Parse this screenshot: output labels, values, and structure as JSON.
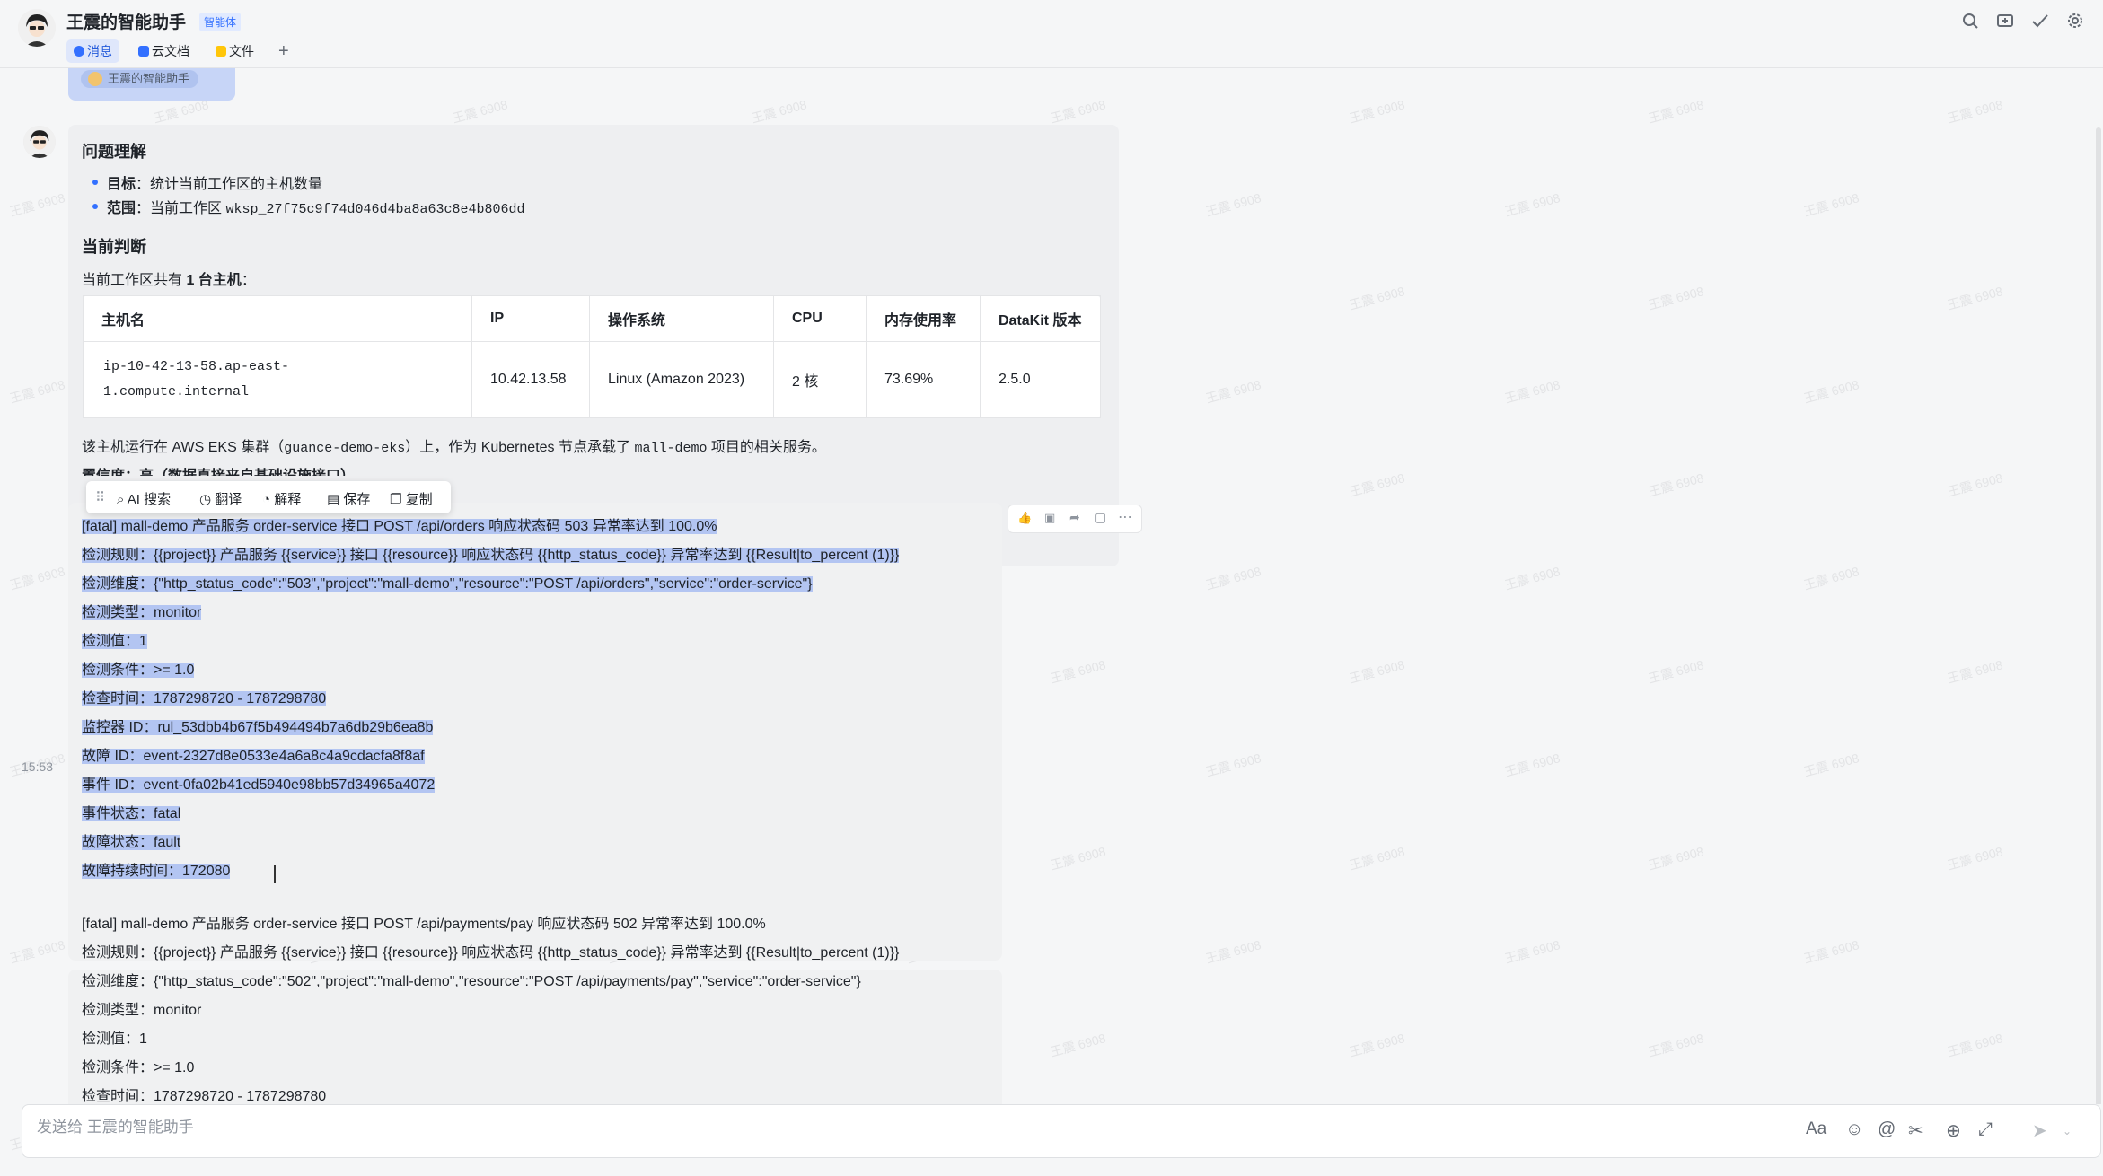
{
  "header": {
    "title": "王震的智能助手",
    "badge": "智能体",
    "tabs": [
      "消息",
      "云文档",
      "文件"
    ],
    "add_tab": "+"
  },
  "top_mention": "王震的智能助手",
  "ai_message": {
    "section1_title": "问题理解",
    "bullets": [
      {
        "label": "目标",
        "sep": "：",
        "text": "统计当前工作区的主机数量",
        "code": ""
      },
      {
        "label": "范围",
        "sep": "：",
        "text": "当前工作区 ",
        "code": "wksp_27f75c9f74d046d4ba8a63c8e4b806dd"
      }
    ],
    "section2_title": "当前判断",
    "summary_pre": "当前工作区共有 ",
    "summary_bold": "1 台主机",
    "summary_post": "：",
    "table": {
      "headers": [
        "主机名",
        "IP",
        "操作系统",
        "CPU",
        "内存使用率",
        "DataKit 版本"
      ],
      "row": {
        "hostname_line1": "ip-10-42-13-58.ap-east-",
        "hostname_line2": "1.compute.internal",
        "ip": "10.42.13.58",
        "os": "Linux (Amazon 2023)",
        "cpu": "2 核",
        "mem": "73.69%",
        "datakit": "2.5.0"
      }
    },
    "note_pre": "该主机运行在 AWS EKS 集群（",
    "note_code1": "guance-demo-eks",
    "note_mid": "）上，作为 Kubernetes 节点承载了 ",
    "note_code2": "mall-demo",
    "note_post": " 项目的相关服务。",
    "confidence": "置信度：高（数据直接来自基础设施接口）"
  },
  "toolbar": {
    "ai_search": "AI 搜索",
    "translate": "翻译",
    "explain": "解释",
    "save": "保存",
    "copy": "复制"
  },
  "timestamp": "15:53",
  "alert1": [
    "[fatal] mall-demo 产品服务 order-service 接口 POST /api/orders 响应状态码 503 异常率达到 100.0%",
    "检测规则：{{project}} 产品服务 {{service}} 接口 {{resource}} 响应状态码 {{http_status_code}} 异常率达到 {{Result|to_percent (1)}}",
    "检测维度：{\"http_status_code\":\"503\",\"project\":\"mall-demo\",\"resource\":\"POST /api/orders\",\"service\":\"order-service\"}",
    "检测类型：monitor",
    "检测值：1",
    "检测条件：>= 1.0",
    "检查时间：1787298720 - 1787298780",
    "监控器 ID：rul_53dbb4b67f5b494494b7a6db29b6ea8b",
    "故障 ID：event-2327d8e0533e4a6a8c4a9cdacfa8f8af",
    "事件 ID：event-0fa02b41ed5940e98bb57d34965a4072",
    "事件状态：fatal",
    "故障状态：fault",
    "故障持续时间：172080"
  ],
  "alert2": [
    "[fatal] mall-demo 产品服务 order-service 接口 POST /api/payments/pay 响应状态码 502 异常率达到 100.0%",
    "检测规则：{{project}} 产品服务 {{service}} 接口 {{resource}} 响应状态码 {{http_status_code}} 异常率达到 {{Result|to_percent (1)}}",
    "检测维度：{\"http_status_code\":\"502\",\"project\":\"mall-demo\",\"resource\":\"POST /api/payments/pay\",\"service\":\"order-service\"}",
    "检测类型：monitor",
    "检测值：1",
    "检测条件：>= 1.0",
    "检查时间：1787298720 - 1787298780"
  ],
  "input": {
    "placeholder": "发送给 王震的智能助手",
    "font_button": "Aa"
  },
  "watermark": "王震 6908"
}
